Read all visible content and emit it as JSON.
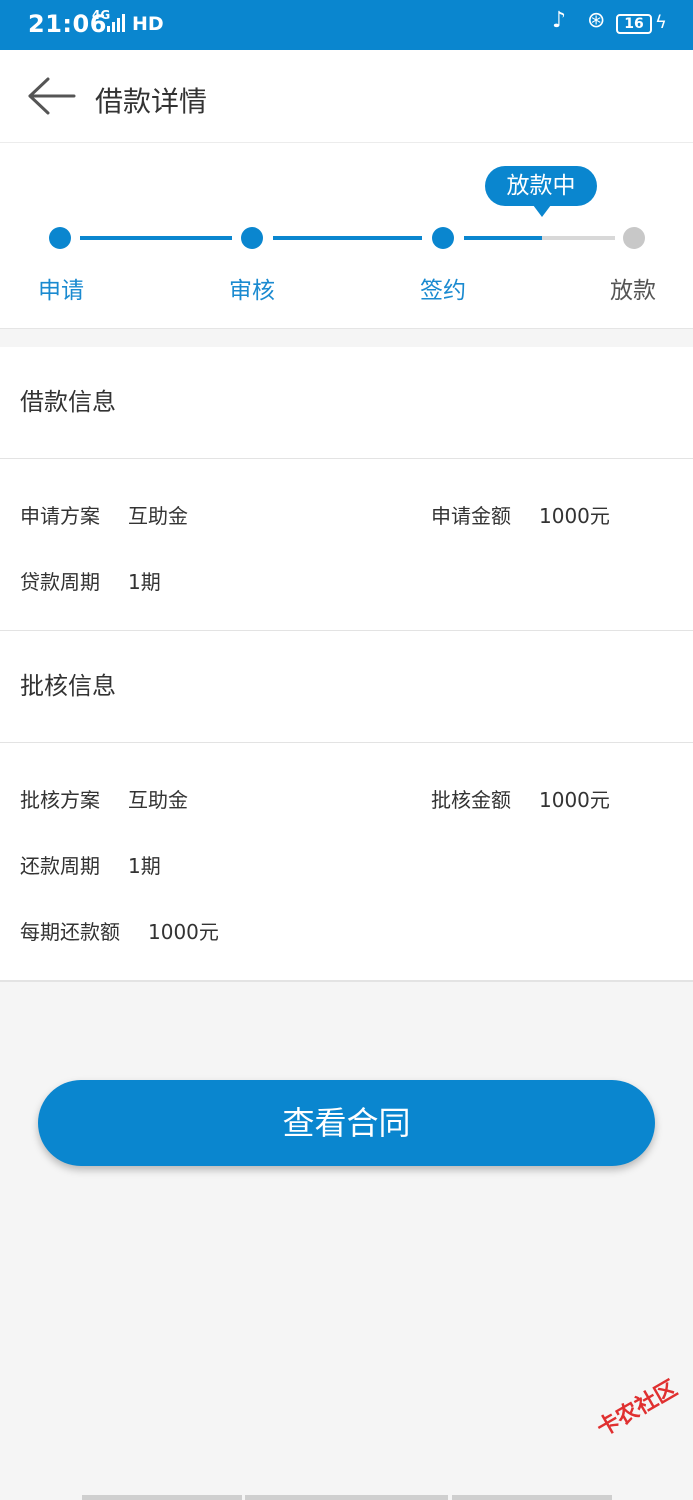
{
  "status_bar": {
    "time": "21:06",
    "network": "4G",
    "hd": "HD",
    "battery": "16"
  },
  "app_bar": {
    "title": "借款详情"
  },
  "progress": {
    "current_badge": "放款中",
    "steps": [
      {
        "label": "申请",
        "status": "done"
      },
      {
        "label": "审核",
        "status": "done"
      },
      {
        "label": "签约",
        "status": "done"
      },
      {
        "label": "放款",
        "status": "pending"
      }
    ]
  },
  "loan_info": {
    "title": "借款信息",
    "plan_label": "申请方案",
    "plan_value": "互助金",
    "amount_label": "申请金额",
    "amount_value": "1000元",
    "term_label": "贷款周期",
    "term_value": "1期"
  },
  "approval_info": {
    "title": "批核信息",
    "plan_label": "批核方案",
    "plan_value": "互助金",
    "amount_label": "批核金额",
    "amount_value": "1000元",
    "term_label": "还款周期",
    "term_value": "1期",
    "installment_label": "每期还款额",
    "installment_value": "1000元"
  },
  "actions": {
    "view_contract": "查看合同"
  },
  "watermark": "卡农社区",
  "colors": {
    "primary": "#0a86cf",
    "pending": "#c8c8c8",
    "background": "#f5f5f5"
  }
}
